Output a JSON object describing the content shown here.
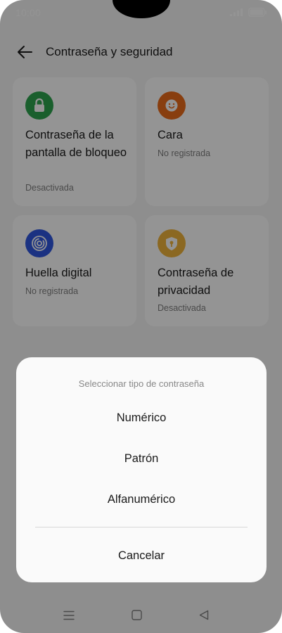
{
  "status": {
    "time": "10:00"
  },
  "header": {
    "title": "Contraseña y seguridad"
  },
  "cards": [
    {
      "title": "Contraseña de la pantalla de bloqueo",
      "subtitle": "Desactivada",
      "icon": "lock-icon",
      "color": "#2ea44f"
    },
    {
      "title": "Cara",
      "subtitle": "No registrada",
      "icon": "face-icon",
      "color": "#ea6b1a"
    },
    {
      "title": "Huella digital",
      "subtitle": "No registrada",
      "icon": "fingerprint-icon",
      "color": "#2f57e0"
    },
    {
      "title": "Contraseña de privacidad",
      "subtitle": "Desactivada",
      "icon": "shield-key-icon",
      "color": "#f0b43c"
    }
  ],
  "dialog": {
    "title": "Seleccionar tipo de contraseña",
    "options": [
      "Numérico",
      "Patrón",
      "Alfanumérico"
    ],
    "cancel": "Cancelar"
  }
}
